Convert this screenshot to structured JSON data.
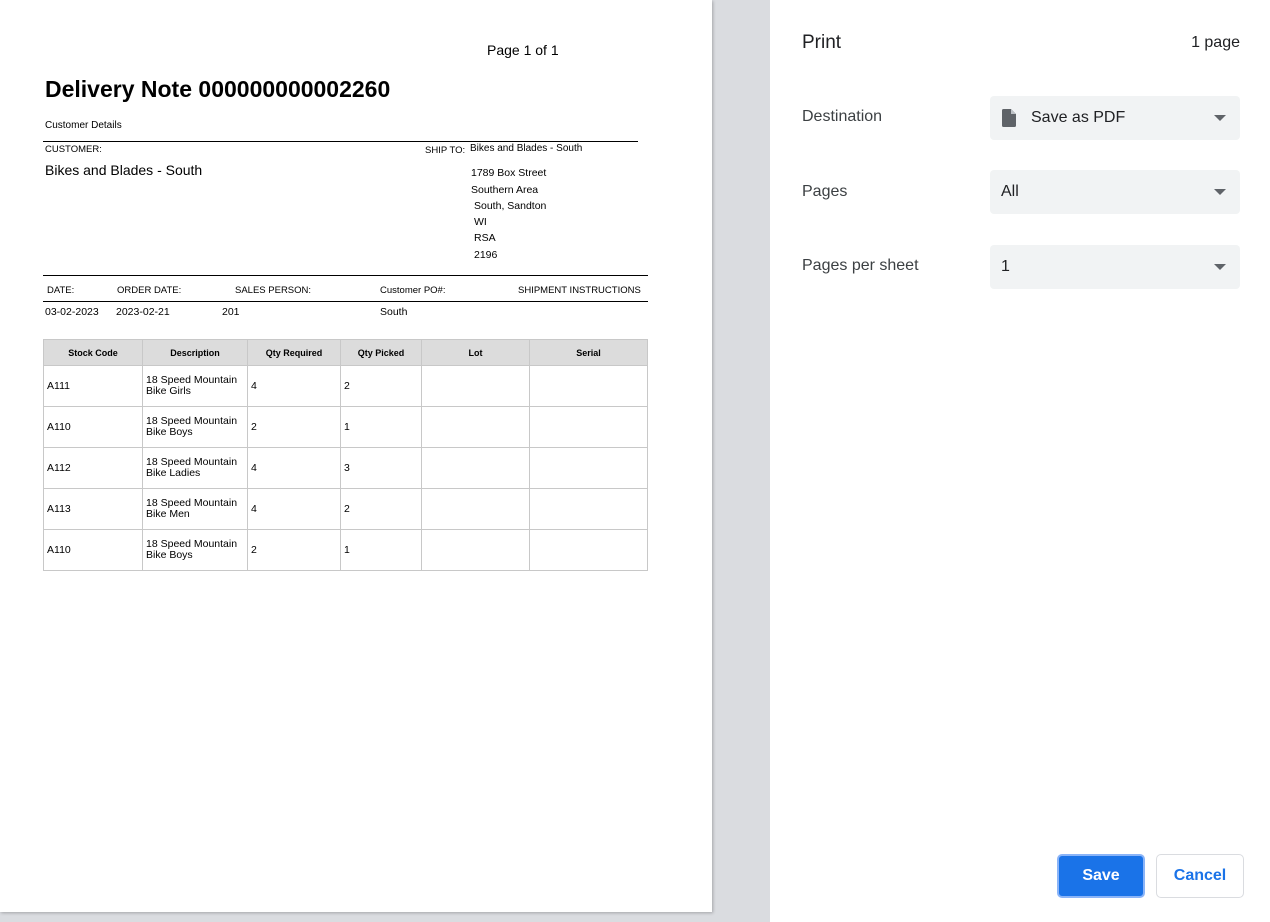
{
  "preview": {
    "page_number": "Page 1 of 1",
    "title": "Delivery Note 000000000002260",
    "customer_details_label": "Customer Details",
    "customer_label": "CUSTOMER:",
    "customer_name": "Bikes and Blades - South",
    "ship_to_label": "SHIP TO:",
    "ship_to_name": "Bikes and Blades - South",
    "ship_to_address": [
      "1789 Box Street",
      "Southern Area",
      "South, Sandton",
      "WI",
      "RSA",
      "2196"
    ],
    "info_headers": {
      "date": "DATE:",
      "order_date": "ORDER DATE:",
      "sales_person": "SALES PERSON:",
      "customer_po": "Customer PO#:",
      "shipment_instructions": "SHIPMENT INSTRUCTIONS"
    },
    "info_values": {
      "date": "03-02-2023",
      "order_date": "2023-02-21",
      "sales_person": "201",
      "customer_po": "South"
    },
    "table": {
      "columns": [
        "Stock Code",
        "Description",
        "Qty Required",
        "Qty Picked",
        "Lot",
        "Serial"
      ],
      "rows": [
        {
          "stock_code": "A111",
          "description": "18 Speed Mountain Bike Girls",
          "qty_required": "4",
          "qty_picked": "2",
          "lot": "",
          "serial": ""
        },
        {
          "stock_code": "A110",
          "description": "18 Speed Mountain Bike Boys",
          "qty_required": "2",
          "qty_picked": "1",
          "lot": "",
          "serial": ""
        },
        {
          "stock_code": "A112",
          "description": "18 Speed Mountain Bike Ladies",
          "qty_required": "4",
          "qty_picked": "3",
          "lot": "",
          "serial": ""
        },
        {
          "stock_code": "A113",
          "description": "18 Speed Mountain Bike Men",
          "qty_required": "4",
          "qty_picked": "2",
          "lot": "",
          "serial": ""
        },
        {
          "stock_code": "A110",
          "description": "18 Speed Mountain Bike Boys",
          "qty_required": "2",
          "qty_picked": "1",
          "lot": "",
          "serial": ""
        }
      ]
    }
  },
  "settings": {
    "title": "Print",
    "sheet_count": "1 page",
    "destination": {
      "label": "Destination",
      "value": "Save as PDF",
      "icon": "pdf-file-icon"
    },
    "pages": {
      "label": "Pages",
      "value": "All"
    },
    "pages_per_sheet": {
      "label": "Pages per sheet",
      "value": "1"
    },
    "save_label": "Save",
    "cancel_label": "Cancel"
  },
  "colors": {
    "accent": "#1a73e8",
    "select_bg": "#f1f3f4",
    "preview_bg": "#dadce0"
  }
}
